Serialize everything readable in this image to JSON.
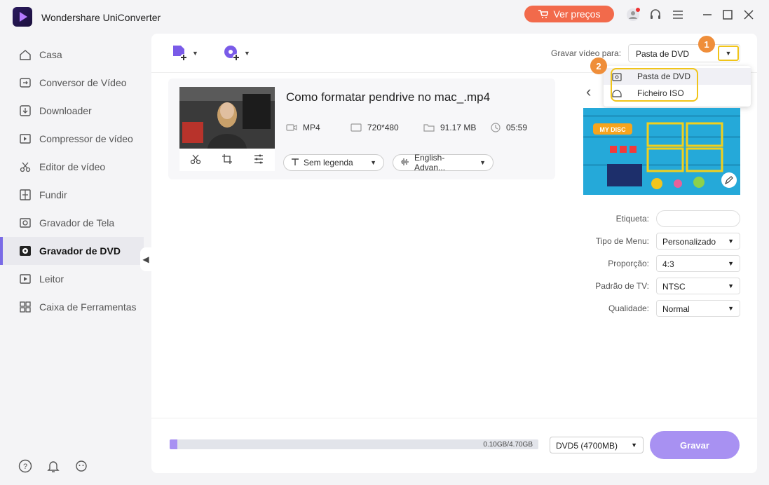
{
  "app": {
    "title": "Wondershare UniConverter",
    "price_button": "Ver preços",
    "accent_color": "#7a6be6",
    "price_color": "#f26a4b"
  },
  "sidebar": {
    "items": [
      {
        "label": "Casa",
        "icon": "home-icon"
      },
      {
        "label": "Conversor de Vídeo",
        "icon": "convert-icon"
      },
      {
        "label": "Downloader",
        "icon": "download-icon"
      },
      {
        "label": "Compressor de vídeo",
        "icon": "compress-icon"
      },
      {
        "label": "Editor de vídeo",
        "icon": "scissors-icon"
      },
      {
        "label": "Fundir",
        "icon": "merge-icon"
      },
      {
        "label": "Gravador de Tela",
        "icon": "screen-record-icon"
      },
      {
        "label": "Gravador de DVD",
        "icon": "dvd-icon",
        "active": true
      },
      {
        "label": "Leitor",
        "icon": "player-icon"
      },
      {
        "label": "Caixa de Ferramentas",
        "icon": "toolbox-icon"
      }
    ]
  },
  "toolbar": {
    "burn_label": "Gravar vídeo para:",
    "burn_value": "Pasta de DVD",
    "dropdown_options": [
      "Pasta de DVD",
      "Ficheiro ISO"
    ],
    "step1": "1",
    "step2": "2"
  },
  "video": {
    "title": "Como formatar pendrive no mac_.mp4",
    "format": "MP4",
    "resolution": "720*480",
    "size": "91.17 MB",
    "duration": "05:59",
    "subtitle": "Sem legenda",
    "audio": "English-Advan..."
  },
  "template": {
    "title": "MY DISC"
  },
  "form": {
    "label_label": "Etiqueta:",
    "label_value": "",
    "menu_label": "Tipo de Menu:",
    "menu_value": "Personalizado",
    "ratio_label": "Proporção:",
    "ratio_value": "4:3",
    "tv_label": "Padrão de TV:",
    "tv_value": "NTSC",
    "quality_label": "Qualidade:",
    "quality_value": "Normal"
  },
  "bottom": {
    "progress_text": "0.10GB/4.70GB",
    "progress_fraction": 0.021,
    "disc_type": "DVD5 (4700MB)",
    "burn_button": "Gravar"
  }
}
